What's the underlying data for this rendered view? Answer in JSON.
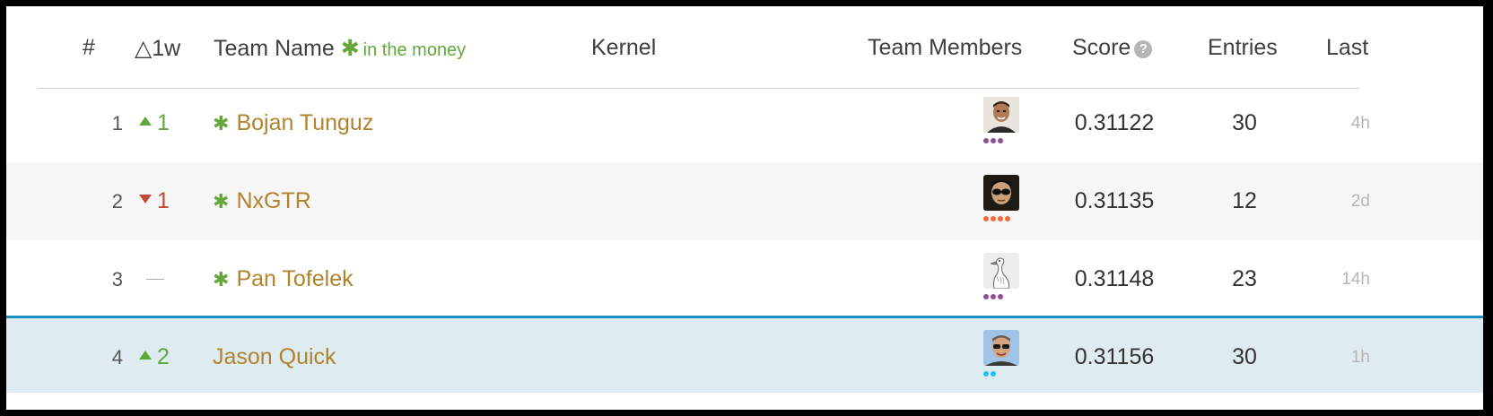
{
  "header": {
    "rank_label": "#",
    "delta_label": "△1w",
    "team_name_label": "Team Name",
    "in_money_label": "in the money",
    "kernel_label": "Kernel",
    "members_label": "Team Members",
    "score_label": "Score",
    "help_symbol": "?",
    "entries_label": "Entries",
    "last_label": "Last"
  },
  "rows": [
    {
      "rank": "1",
      "delta": "1",
      "delta_dir": "up",
      "in_money": true,
      "team": "Bojan Tunguz",
      "score": "0.31122",
      "entries": "30",
      "last": "4h",
      "tier_color": "#8f4f95",
      "tier_dots": 3
    },
    {
      "rank": "2",
      "delta": "1",
      "delta_dir": "down",
      "in_money": true,
      "team": "NxGTR",
      "score": "0.31135",
      "entries": "12",
      "last": "2d",
      "tier_color": "#f26b38",
      "tier_dots": 4
    },
    {
      "rank": "3",
      "delta": "",
      "delta_dir": "same",
      "in_money": true,
      "team": "Pan Tofelek",
      "score": "0.31148",
      "entries": "23",
      "last": "14h",
      "tier_color": "#8f4f95",
      "tier_dots": 3
    },
    {
      "rank": "4",
      "delta": "2",
      "delta_dir": "up",
      "in_money": false,
      "team": "Jason Quick",
      "score": "0.31156",
      "entries": "30",
      "last": "1h",
      "tier_color": "#20beff",
      "tier_dots": 2
    }
  ],
  "colors": {
    "in_money": "#63a839",
    "team_link": "#b1832a",
    "up": "#5ea93a",
    "down": "#c24a3b",
    "highlight_row": "#deebf1",
    "highlight_border": "#1b8fc4"
  }
}
